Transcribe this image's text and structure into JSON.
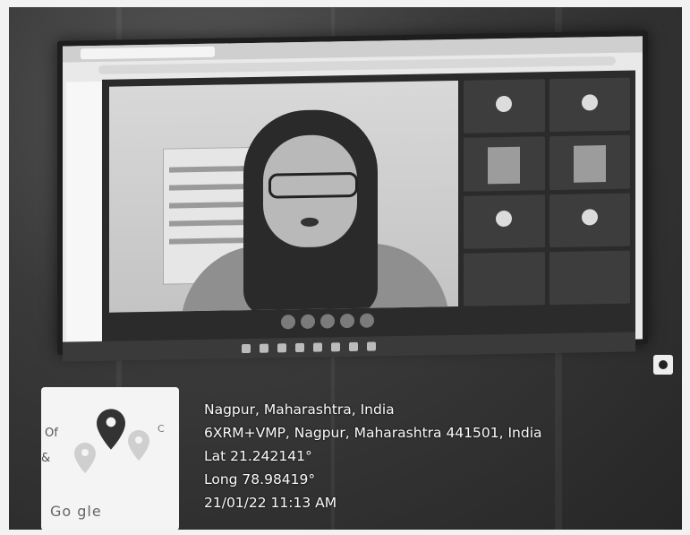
{
  "location": {
    "title": "Nagpur, Maharashtra, India",
    "address": "6XRM+VMP, Nagpur, Maharashtra 441501, India",
    "lat": "Lat 21.242141°",
    "long": "Long 78.98419°",
    "datetime": "21/01/22 11:13 AM"
  },
  "map": {
    "attribution": "Go gle",
    "fragment_left": "Of",
    "fragment_amp": "&",
    "fragment_right": "C"
  },
  "icons": {
    "map_pin": "map-pin-icon",
    "camera_logo": "camera-logo-icon"
  },
  "colors": {
    "pin_dark": "#333333",
    "pin_light": "#cfcfcf",
    "overlay_text": "#fafafa"
  }
}
